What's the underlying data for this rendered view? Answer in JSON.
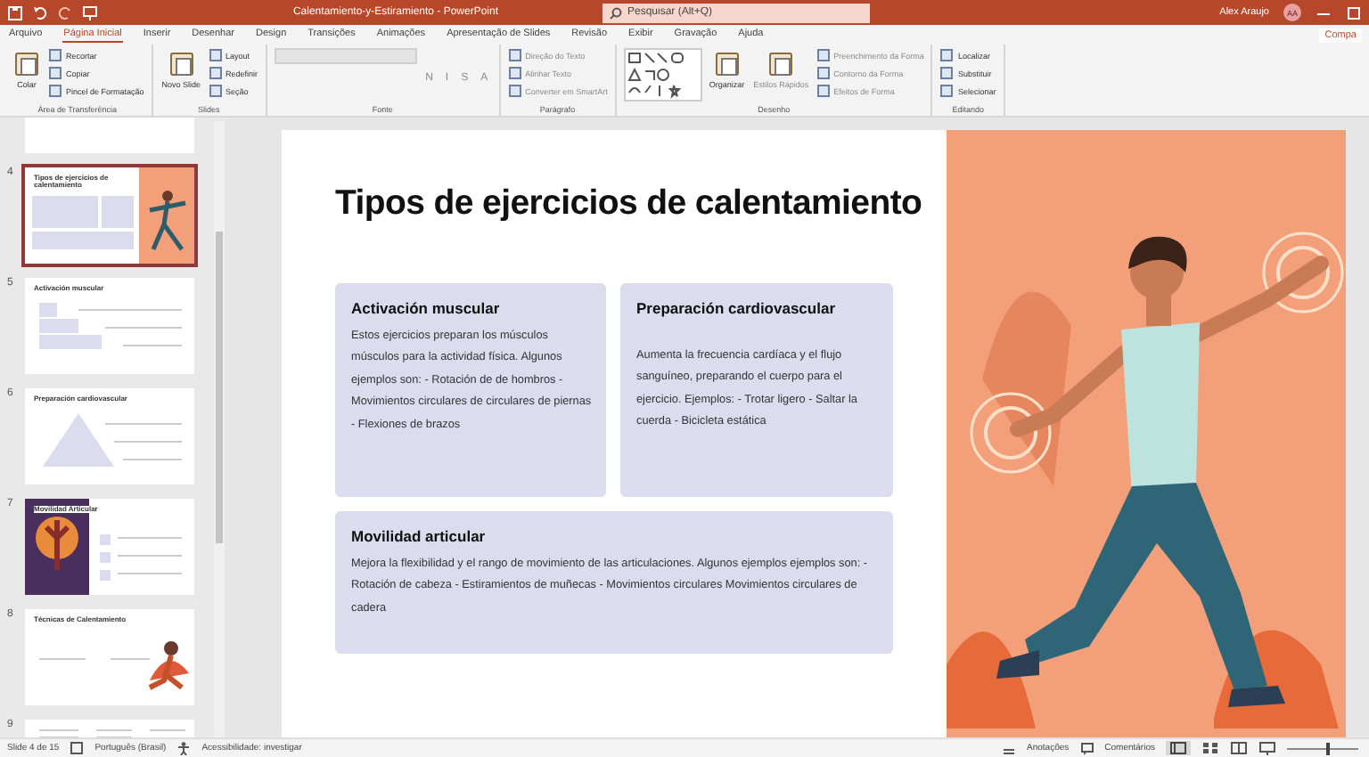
{
  "window": {
    "title": "Calentamiento-y-Estiramiento - PowerPoint",
    "search_placeholder": "Pesquisar (Alt+Q)",
    "user": "Alex Araujo",
    "initials": "AA"
  },
  "tabs": [
    {
      "label": "Arquivo",
      "selected": false
    },
    {
      "label": "Página Inicial",
      "selected": true
    },
    {
      "label": "Inserir",
      "selected": false
    },
    {
      "label": "Desenhar",
      "selected": false
    },
    {
      "label": "Design",
      "selected": false
    },
    {
      "label": "Transições",
      "selected": false
    },
    {
      "label": "Animações",
      "selected": false
    },
    {
      "label": "Apresentação de Slides",
      "selected": false
    },
    {
      "label": "Revisão",
      "selected": false
    },
    {
      "label": "Exibir",
      "selected": false
    },
    {
      "label": "Gravação",
      "selected": false
    },
    {
      "label": "Ajuda",
      "selected": false
    }
  ],
  "share_button": "Compa",
  "ribbon": [
    {
      "label": "Área de Transferência",
      "items": [
        {
          "kind": "large",
          "label": "Colar",
          "disabled": false
        },
        {
          "kind": "small",
          "label": "Recortar",
          "disabled": false
        },
        {
          "kind": "small",
          "label": "Copiar",
          "disabled": false
        },
        {
          "kind": "small",
          "label": "Pincel de Formatação",
          "disabled": false
        }
      ]
    },
    {
      "label": "Slides",
      "items": [
        {
          "kind": "large",
          "label": "Novo Slide",
          "disabled": false
        },
        {
          "kind": "small",
          "label": "Layout",
          "disabled": false
        },
        {
          "kind": "small",
          "label": "Redefinir",
          "disabled": false
        },
        {
          "kind": "small",
          "label": "Seção",
          "disabled": false
        }
      ]
    },
    {
      "label": "Fonte",
      "items": [
        {
          "kind": "fontbox",
          "disabled": true
        },
        {
          "kind": "glyph",
          "label": "N",
          "disabled": true
        },
        {
          "kind": "glyph",
          "label": "I",
          "disabled": true
        },
        {
          "kind": "glyph",
          "label": "S",
          "disabled": true
        },
        {
          "kind": "glyph",
          "label": "A",
          "disabled": true
        }
      ]
    },
    {
      "label": "Parágrafo",
      "items": [
        {
          "kind": "small",
          "label": "Direção do Texto",
          "disabled": true
        },
        {
          "kind": "small",
          "label": "Alinhar Texto",
          "disabled": true
        },
        {
          "kind": "small",
          "label": "Converter em SmartArt",
          "disabled": true
        }
      ]
    },
    {
      "label": "Desenho",
      "items": [
        {
          "kind": "shapes"
        },
        {
          "kind": "large",
          "label": "Organizar",
          "disabled": false
        },
        {
          "kind": "large",
          "label": "Estilos Rápidos",
          "disabled": true
        },
        {
          "kind": "small",
          "label": "Preenchimento da Forma",
          "disabled": true
        },
        {
          "kind": "small",
          "label": "Contorno da Forma",
          "disabled": true
        },
        {
          "kind": "small",
          "label": "Efeitos de Forma",
          "disabled": true
        }
      ]
    },
    {
      "label": "Editando",
      "items": [
        {
          "kind": "small",
          "label": "Localizar",
          "disabled": false
        },
        {
          "kind": "small",
          "label": "Substituir",
          "disabled": false
        },
        {
          "kind": "small",
          "label": "Selecionar",
          "disabled": false
        }
      ]
    }
  ],
  "thumbnails": [
    {
      "kind": "text",
      "selected": false
    },
    {
      "number": "4",
      "title": "Tipos de ejercicios de calentamiento",
      "kind": "cards",
      "selected": true
    },
    {
      "number": "5",
      "title": "Activación muscular",
      "kind": "steps",
      "selected": false
    },
    {
      "number": "6",
      "title": "Preparación cardiovascular",
      "kind": "pyramid",
      "selected": false
    },
    {
      "number": "7",
      "title": "Movilidad Articular",
      "kind": "image-left",
      "selected": false
    },
    {
      "number": "8",
      "title": "Técnicas de Calentamiento",
      "kind": "image-right",
      "selected": false
    },
    {
      "number": "9",
      "kind": "text",
      "selected": false
    }
  ],
  "slide": {
    "title": "Tipos de ejercicios de calentamiento",
    "cards": [
      {
        "heading": "Activación muscular",
        "body": "Estos ejercicios preparan los músculos músculos para la actividad física. Algunos ejemplos son: - Rotación de de hombros - Movimientos circulares de circulares de piernas - Flexiones de brazos"
      },
      {
        "heading": "Preparación cardiovascular",
        "body": "Aumenta la frecuencia cardíaca y el flujo sanguíneo, preparando el cuerpo para el ejercicio. Ejemplos: - Trotar ligero - Saltar la cuerda - Bicicleta estática"
      },
      {
        "heading": "Movilidad articular",
        "body": "Mejora la flexibilidad y el rango de movimiento de las articulaciones. Algunos ejemplos ejemplos son: - Rotación de cabeza - Estiramientos de muñecas - Movimientos circulares Movimientos circulares de cadera"
      }
    ]
  },
  "status_bar": {
    "slide_counter": "Slide 4 de 15",
    "language": "Português (Brasil)",
    "accessibility": "Acessibilidade: investigar",
    "notes": "Anotações",
    "comments": "Comentários",
    "zoom": {
      "level": 0.55
    }
  }
}
